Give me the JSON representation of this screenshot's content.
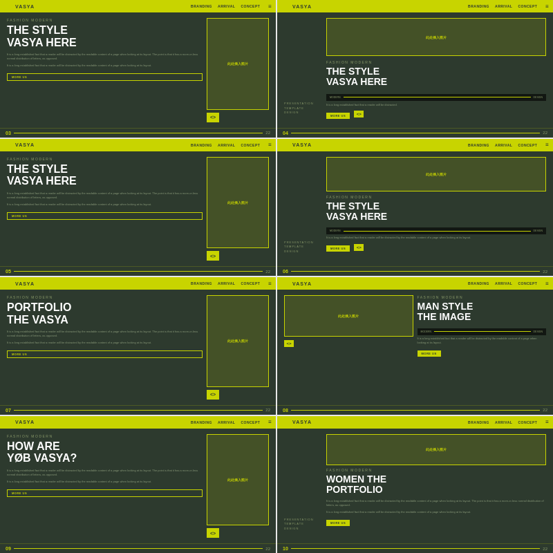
{
  "slides": [
    {
      "id": "slide-03",
      "num": "03",
      "total": "22",
      "header": {
        "logo": "VASYA",
        "nav": [
          "BRANDING",
          "ARRIVAL",
          "CONCEPT"
        ],
        "icon": "◆"
      },
      "fashion_label": "FASHION MODERN",
      "title_line1": "THE STYLE",
      "title_line2": "VASYA HERE",
      "body_text_1": "It is a long established fact that a reader will be distracted by the readable content of a page when looking at its layout. The point is that it has a more-or-less normal distribution of letters, as opposed.",
      "body_text_2": "It is a long established fact that a reader will be distracted by the readable content of a page when looking at its layout.",
      "more_label": "MORE US",
      "image_label": "此处插入图片",
      "has_right_image": false,
      "has_center_image": true,
      "layout": "left-image"
    },
    {
      "id": "slide-04",
      "num": "04",
      "total": "22",
      "header": {
        "logo": "VASYA",
        "nav": [
          "BRANDING",
          "ARRIVAL",
          "CONCEPT"
        ],
        "icon": "◆"
      },
      "presentation_label": "PRESENTATION\nTEMPLATE\nDESIGN",
      "fashion_label": "FASHION MODERN",
      "title_line1": "THE STYLE",
      "title_line2": "VASYA HERE",
      "body_text_1": "It is a long established fact that a reader will be distracted.",
      "modern_label": "MODERN",
      "design_label": "DESIGN",
      "more_label": "MORE US",
      "image_label": "此处插入图片",
      "layout": "right-image-dark"
    },
    {
      "id": "slide-05",
      "num": "05",
      "total": "22",
      "header": {
        "logo": "VASYA",
        "nav": [
          "BRANDING",
          "ARRIVAL",
          "CONCEPT"
        ],
        "icon": "◆"
      },
      "fashion_label": "FASHION MODERN",
      "title_line1": "THE STYLE",
      "title_line2": "VASYA HERE",
      "body_text_1": "It is a long established fact that a reader will be distracted by the readable content of a page when looking at its layout. The point is that it has a more-or-less normal distribution of letters, as opposed.",
      "body_text_2": "It is a long established fact that a reader will be distracted by the readable content of a page when looking at its layout.",
      "more_label": "MORE US",
      "image_label": "此处插入图片",
      "layout": "left-image"
    },
    {
      "id": "slide-06",
      "num": "06",
      "total": "22",
      "header": {
        "logo": "VASYA",
        "nav": [
          "BRANDING",
          "ARRIVAL",
          "CONCEPT"
        ],
        "icon": "◆"
      },
      "presentation_label": "PRESENTATION\nTEMPLATE\nDESIGN",
      "fashion_label": "FASHION MODERN",
      "title_line1": "THE STYLE",
      "title_line2": "VASYA HERE",
      "body_text_1": "It is a long established fact that a reader will be distracted by the readable content of a page when looking at its layout.",
      "modern_label": "MODERN",
      "design_label": "DESIGN",
      "more_label": "MORE US",
      "image_label": "此处插入图片",
      "layout": "right-image-dark"
    },
    {
      "id": "slide-07",
      "num": "07",
      "total": "22",
      "header": {
        "logo": "VASYA",
        "nav": [
          "BRANDING",
          "ARRIVAL",
          "CONCEPT"
        ],
        "icon": "◆"
      },
      "fashion_label": "FASHION MODERN",
      "title_line1": "PORTFOLIO",
      "title_line2": "THE VASYA",
      "body_text_1": "It is a long established fact that a reader will be distracted by the readable content of a page when looking at its layout. The point is that it has a more-or-less normal distribution of letters, as opposed.",
      "body_text_2": "It is a long established fact that a reader will be distracted by the readable content of a page when looking at its layout.",
      "more_label": "MORE US",
      "image_label": "此处插入图片",
      "layout": "left-image"
    },
    {
      "id": "slide-08",
      "num": "08",
      "total": "22",
      "header": {
        "logo": "VASYA",
        "nav": [
          "BRANDING",
          "ARRIVAL",
          "CONCEPT"
        ],
        "icon": "◆"
      },
      "fashion_label": "FASHION MODERN",
      "title_line1": "MAN STYLE",
      "title_line2": "THE IMAGE",
      "body_text_1": "It is a long established fact that a reader will be distracted by the readable content of a page when looking at its layout.",
      "modern_label": "MODERN",
      "design_label": "DESIGN",
      "more_label": "MORE US",
      "image_label": "此处插入图片",
      "layout": "right-image-dark"
    },
    {
      "id": "slide-09",
      "num": "09",
      "total": "22",
      "header": {
        "logo": "VASYA",
        "nav": [
          "BRANDING",
          "ARRIVAL",
          "CONCEPT"
        ],
        "icon": "◆"
      },
      "fashion_label": "FASHION MODERN",
      "title_line1": "HOW ARE",
      "title_line2": "YØB VASYA?",
      "body_text_1": "It is a long established fact that a reader will be distracted by the readable content of a page when looking at its layout. The point is that it has a more-or-less normal distribution of letters, as opposed.",
      "body_text_2": "It is a long established fact that a reader will be distracted by the readable content of a page when looking at its layout.",
      "more_label": "MORE US",
      "image_label": "此处插入图片",
      "layout": "left-image"
    },
    {
      "id": "slide-10",
      "num": "10",
      "total": "22",
      "header": {
        "logo": "VASYA",
        "nav": [
          "BRANDING",
          "ARRIVAL",
          "CONCEPT"
        ],
        "icon": "◆"
      },
      "presentation_label": "PRESENTATION\nTEMPLATE\nDESIGN",
      "fashion_label": "FASHION MODERN",
      "title_line1": "WOMEN THE",
      "title_line2": "PORTFOLIO",
      "body_text_1": "It is a long established fact that a reader will be distracted by the readable content of a page when looking at its layout. The point is that it has a more-or-less normal distribution of letters, as opposed.",
      "body_text_2": "It is a long established fact that a reader will be distracted by the readable content of a page when looking at its layout.",
      "more_label": "MORE US",
      "image_label": "此处插入图片",
      "layout": "two-images"
    }
  ],
  "colors": {
    "bg_dark": "#2d3a2e",
    "accent": "#c8d400",
    "text_light": "#ffffff",
    "text_muted": "#8a9a6a",
    "header_bg": "#c8d400"
  }
}
